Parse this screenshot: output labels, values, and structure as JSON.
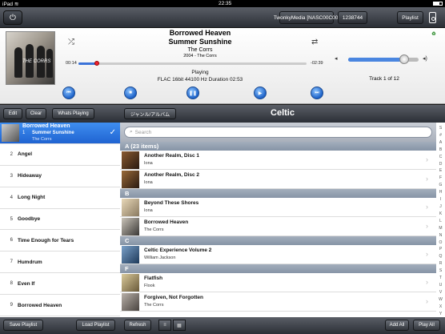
{
  "status_bar": {
    "device": "iPad",
    "wifi": "≋",
    "time": "22:35"
  },
  "top_bar": {
    "server_label": "TwonkyMedia [NASC00C00]",
    "renderer_label": "1238744",
    "playlist_label": "Playlist"
  },
  "now_playing": {
    "album": "Borrowed Heaven",
    "title": "Summer Sunshine",
    "artist": "The Corrs",
    "year_artist": "2004 - The Corrs",
    "elapsed": "00:14",
    "remaining": "-02:39",
    "progress_fraction": 0.08,
    "volume_fraction": 0.8,
    "status": "Playing",
    "format": "FLAC 16bit 44100 Hz Duration 02:53",
    "track_info": "Track 1 of 12",
    "album_art_text": "THE CORRS"
  },
  "left_toolbar": {
    "edit": "Edit",
    "clear": "Clear",
    "whats_playing": "Whats Playing"
  },
  "playlist": {
    "active": {
      "album": "Borrowed Heaven",
      "num": "1",
      "title": "Summer Sunshine",
      "artist": "The Corrs"
    },
    "items": [
      {
        "num": "2",
        "title": "Angel"
      },
      {
        "num": "3",
        "title": "Hideaway"
      },
      {
        "num": "4",
        "title": "Long Night"
      },
      {
        "num": "5",
        "title": "Goodbye"
      },
      {
        "num": "6",
        "title": "Time Enough for Tears"
      },
      {
        "num": "7",
        "title": "Humdrum"
      },
      {
        "num": "8",
        "title": "Even If"
      },
      {
        "num": "9",
        "title": "Borrowed Heaven"
      }
    ]
  },
  "left_bottom": {
    "save": "Save Playlist",
    "load": "Load Playlist"
  },
  "browser": {
    "genre_button": "ジャンル/アルバム",
    "title": "Celtic",
    "search_placeholder": "Search",
    "sections": [
      {
        "header": "A (23 items)",
        "rows": [
          {
            "title": "Another Realm, Disc 1",
            "artist": "Iona"
          },
          {
            "title": "Another Realm, Disc 2",
            "artist": "Iona"
          }
        ]
      },
      {
        "header": "B",
        "rows": [
          {
            "title": "Beyond These Shores",
            "artist": "Iona"
          },
          {
            "title": "Borrowed Heaven",
            "artist": "The Corrs"
          }
        ]
      },
      {
        "header": "C",
        "rows": [
          {
            "title": "Celtic Experience Volume 2",
            "artist": "William Jackson"
          }
        ]
      },
      {
        "header": "F",
        "rows": [
          {
            "title": "Flatfish",
            "artist": "Flook"
          },
          {
            "title": "Forgiven, Not Forgotten",
            "artist": "The Corrs"
          }
        ]
      }
    ],
    "index": [
      "S",
      "#",
      "A",
      "B",
      "C",
      "D",
      "E",
      "F",
      "G",
      "H",
      "I",
      "J",
      "K",
      "L",
      "M",
      "N",
      "O",
      "P",
      "Q",
      "R",
      "S",
      "T",
      "U",
      "V",
      "W",
      "X",
      "Y",
      "Z"
    ]
  },
  "right_bottom": {
    "refresh": "Refresh",
    "view_list": "≡",
    "view_grid": "▦",
    "add_all": "Add All",
    "play_all": "Play All"
  },
  "colors": {
    "accent": "#1f63d1",
    "section_header": "#8694a6",
    "progress_knob": "#e23333"
  }
}
